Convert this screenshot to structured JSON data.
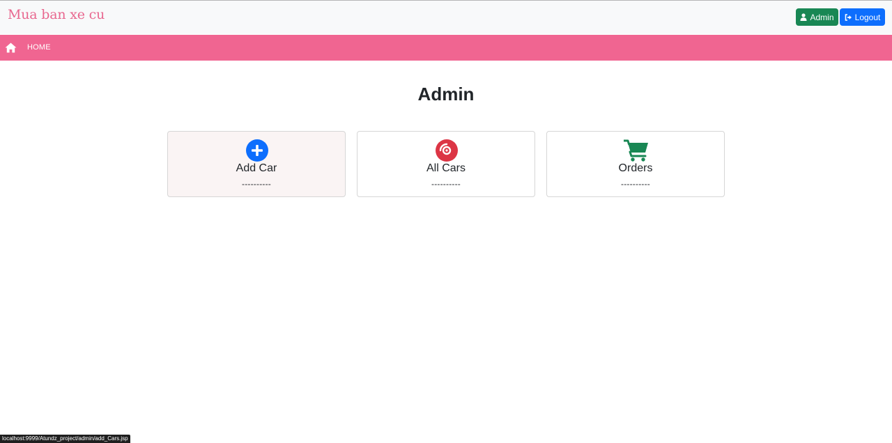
{
  "brand": {
    "name": "Mua ban xe cu"
  },
  "header_buttons": {
    "admin_label": "Admin",
    "logout_label": "Logout"
  },
  "navbar": {
    "home_label": "HOME"
  },
  "page": {
    "title": "Admin"
  },
  "cards": [
    {
      "title": "Add Car",
      "subtitle": "----------",
      "icon": "plus-circle-icon",
      "color": "#0d6efd"
    },
    {
      "title": "All Cars",
      "subtitle": "----------",
      "icon": "disc-icon",
      "color": "#dc3545"
    },
    {
      "title": "Orders",
      "subtitle": "----------",
      "icon": "cart-icon",
      "color": "#198754"
    }
  ],
  "status_bar": {
    "url": "localhost:9999/Atundz_project/admin/add_Cars.jsp"
  },
  "colors": {
    "brand": "#e8678f",
    "navbar": "#f06591",
    "admin_button": "#198754",
    "logout_button": "#0d6efd"
  }
}
